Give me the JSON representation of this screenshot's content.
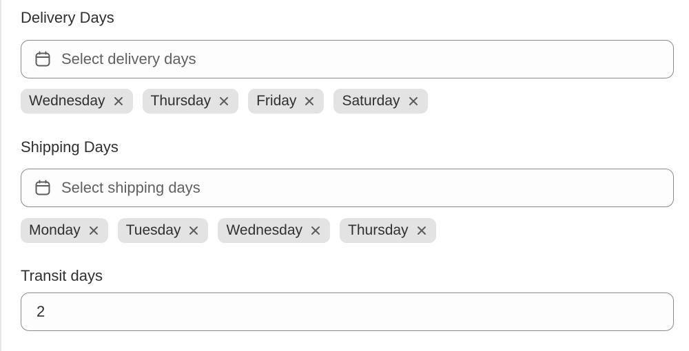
{
  "delivery": {
    "label": "Delivery Days",
    "placeholder": "Select delivery days",
    "icon": "calendar-icon",
    "tags": [
      {
        "label": "Wednesday"
      },
      {
        "label": "Thursday"
      },
      {
        "label": "Friday"
      },
      {
        "label": "Saturday"
      }
    ]
  },
  "shipping": {
    "label": "Shipping Days",
    "placeholder": "Select shipping days",
    "icon": "calendar-icon",
    "tags": [
      {
        "label": "Monday"
      },
      {
        "label": "Tuesday"
      },
      {
        "label": "Wednesday"
      },
      {
        "label": "Thursday"
      }
    ]
  },
  "transit": {
    "label": "Transit days",
    "value": "2"
  },
  "colors": {
    "tag_background": "#e3e3e3",
    "border": "#8a8a8a",
    "text": "#303030",
    "placeholder": "#616161"
  }
}
